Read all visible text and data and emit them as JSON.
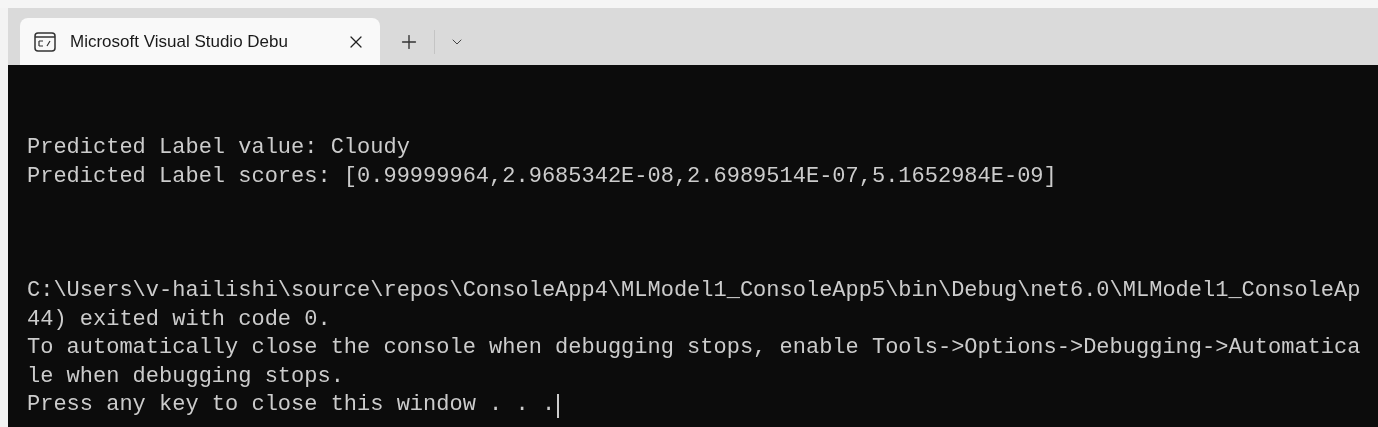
{
  "tab": {
    "title": "Microsoft Visual Studio Debu",
    "selected": true
  },
  "console": {
    "blocks": [
      [
        "Predicted Label value: Cloudy",
        "Predicted Label scores: [0.99999964,2.9685342E-08,2.6989514E-07,5.1652984E-09]"
      ],
      [
        "C:\\Users\\v-hailishi\\source\\repos\\ConsoleApp4\\MLModel1_ConsoleApp5\\bin\\Debug\\net6.0\\MLModel1_ConsoleAp",
        "44) exited with code 0.",
        "To automatically close the console when debugging stops, enable Tools->Options->Debugging->Automatica",
        "le when debugging stops.",
        "Press any key to close this window . . ."
      ]
    ],
    "cursor": true
  }
}
